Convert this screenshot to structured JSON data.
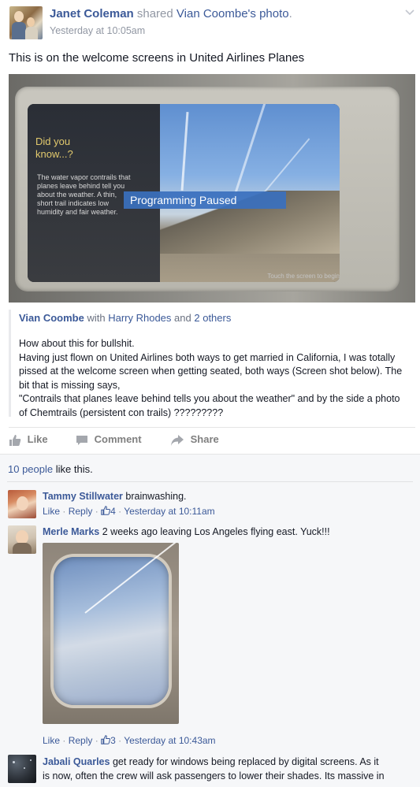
{
  "post": {
    "author": "Janet Coleman",
    "shared_text": "shared",
    "owner_possessive": "Vian Coombe's",
    "photo_word": "photo",
    "period": ".",
    "timestamp": "Yesterday at 10:05am",
    "text": "This is on the welcome screens in United Airlines Planes",
    "photo": {
      "did_you_know": "Did you know...?",
      "fact": "The water vapor contrails that planes leave behind tell you about the weather. A thin, short trail indicates low humidity and fair weather.",
      "overlay": "Programming Paused",
      "screen_caption": "Touch the screen to begin"
    }
  },
  "shared_story": {
    "author": "Vian Coombe",
    "with": "with",
    "tagged": "Harry Rhodes",
    "and": "and",
    "others": "2 others",
    "body": [
      "How about this for bullshit.",
      "Having just flown on United Airlines both ways to get married in California, I was totally pissed at the welcome screen when getting seated, both ways (Screen shot below). The bit that is missing says,",
      "\"Contrails that planes leave behind tells you about the weather\" and by the side a photo of Chemtrails (persistent con trails) ?????????"
    ]
  },
  "actions": {
    "like": "Like",
    "comment": "Comment",
    "share": "Share"
  },
  "likes": {
    "count_text": "10 people",
    "suffix": "like this."
  },
  "comments": [
    {
      "name": "Tammy Stillwater",
      "text": "brainwashing.",
      "like": "Like",
      "reply": "Reply",
      "reactions": "4",
      "time": "Yesterday at 10:11am"
    },
    {
      "name": "Merle Marks",
      "text": "2 weeks ago leaving Los Angeles flying east. Yuck!!!",
      "like": "Like",
      "reply": "Reply",
      "reactions": "3",
      "time": "Yesterday at 10:43am"
    },
    {
      "name": "Jabali Quarles",
      "text_line1": "get ready for windows being replaced by digital screens. As it",
      "text_line2": "is now, often the crew will ask passengers to lower their shades. Its massive in"
    }
  ],
  "separators": {
    "dot": "·"
  },
  "colors": {
    "link": "#3b5998",
    "meta": "#90949c",
    "feedback_bg": "#f6f7f9"
  },
  "icons": [
    "chevron-down-icon",
    "thumbs-up-icon",
    "comment-icon",
    "share-icon"
  ]
}
